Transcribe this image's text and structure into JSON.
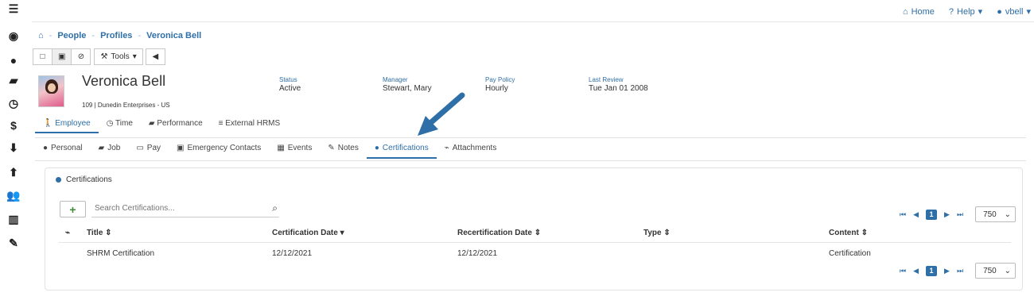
{
  "topnav": {
    "home": "Home",
    "help": "Help",
    "user": "vbell"
  },
  "breadcrumb": [
    "People",
    "Profiles",
    "Veronica Bell"
  ],
  "toolbar": {
    "tools_label": "Tools"
  },
  "profile": {
    "name": "Veronica Bell",
    "sub": "109 | Dunedin Enterprises - US",
    "status_label": "Status",
    "status": "Active",
    "manager_label": "Manager",
    "manager": "Stewart, Mary",
    "pay_policy_label": "Pay Policy",
    "pay_policy": "Hourly",
    "review_label": "Last Review",
    "review": "Tue Jan 01 2008"
  },
  "main_tabs": [
    "Employee",
    "Time",
    "Performance",
    "External HRMS"
  ],
  "sub_tabs": [
    "Personal",
    "Job",
    "Pay",
    "Emergency Contacts",
    "Events",
    "Notes",
    "Certifications",
    "Attachments"
  ],
  "certifications": {
    "title": "Certifications",
    "search_placeholder": "Search Certifications...",
    "page": "1",
    "page_size": "750",
    "headers": [
      "Title",
      "Certification Date",
      "Recertification Date",
      "Type",
      "Content"
    ],
    "rows": [
      {
        "title": "SHRM Certification",
        "cert_date": "12/12/2021",
        "recert_date": "12/12/2021",
        "type": "",
        "content": "Certification"
      }
    ]
  },
  "icons": {
    "home": "home-icon",
    "help": "question-icon",
    "user": "user-icon",
    "menu": "hamburger-icon",
    "add": "plus-icon",
    "search": "search-icon",
    "sort": "sort-icon",
    "attachment": "paperclip-icon"
  },
  "colors": {
    "accent": "#2f6fa7",
    "add": "#3d8b37",
    "arrow": "#2f6fa7"
  }
}
